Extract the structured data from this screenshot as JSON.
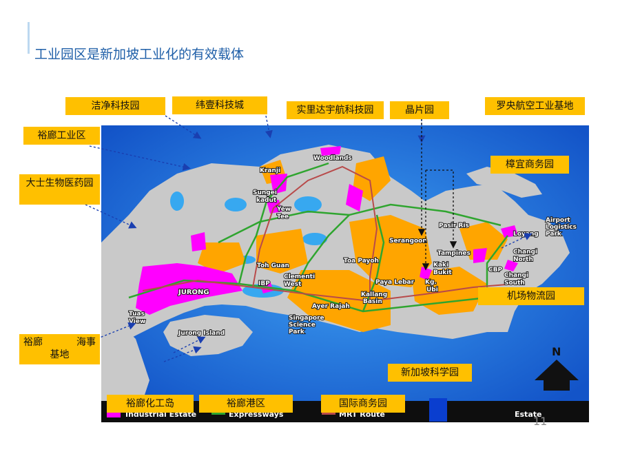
{
  "title": "工业园区是新加坡工业化的有效载体",
  "callouts": {
    "clean_tech": "洁净科技园",
    "one_north": "纬壹科技城",
    "seletar_aero": "实里达宇航科技园",
    "wafer_park": "晶片园",
    "loyang_aero": "罗央航空工业基地",
    "jurong_ind": "裕廊工业区",
    "tuas_bio": "大士生物医药园",
    "changi_biz": "樟宜商务园",
    "airport_logistics": "机场物流园",
    "jurong_marine_a": "裕廊",
    "jurong_marine_b": "海事",
    "jurong_marine_c": "基地",
    "science_park": "新加坡科学园",
    "chem_island": "裕廊化工岛",
    "jurong_port": "裕廊港区",
    "intl_biz": "国际商务园"
  },
  "places": {
    "woodlands": "Woodlands",
    "kranji": "Kranji",
    "sungei_kadut_1": "Sungei",
    "sungei_kadut_2": "kadut",
    "yew_tee_1": "Yew",
    "yew_tee_2": "Tee",
    "serangoon": "Serangoon",
    "pasir_ris": "Pasir Ris",
    "tampines": "Tampines",
    "loyang": "Loyang",
    "airport_logistics_1": "Airport",
    "airport_logistics_2": "Logistics",
    "airport_logistics_3": "Park",
    "changi_north_1": "Changi",
    "changi_north_2": "North",
    "changi_south_1": "Changi",
    "changi_south_2": "South",
    "cbp": "CBP",
    "kaki_bukit_1": "Kaki",
    "kaki_bukit_2": "Bukit",
    "kg_ubi_1": "Kg.",
    "kg_ubi_2": "Ubi",
    "toa_payoh": "Toa Payoh",
    "paya_lebar": "Paya Lebar",
    "kallang_1": "Kallang",
    "kallang_2": "Basin",
    "toh_guan": "Toh Guan",
    "clementi_1": "Clementi",
    "clementi_2": "West",
    "ibp": "IBP",
    "ayer_rajah": "Ayer Rajah",
    "jurong": "JURONG",
    "tuas_1": "Tuas",
    "tuas_2": "View",
    "jurong_island": "Jurong Island",
    "sci_park_1": "Singapore",
    "sci_park_2": "Science",
    "sci_park_3": "Park",
    "north": "N"
  },
  "legend": {
    "industrial": "Industrial Estate",
    "expressways": "Expressways",
    "mrt": "MRT Route",
    "estate": "Estate"
  },
  "page_number": "11",
  "colors": {
    "callout_bg": "#ffc000",
    "sea": "#1e6fd8",
    "land": "#c9c9c9",
    "industrial": "#ff00ff",
    "residential": "#ffa500",
    "expressway": "#2fa52f",
    "mrt": "#b84a4a",
    "legend_blue": "#0a3ecf"
  }
}
